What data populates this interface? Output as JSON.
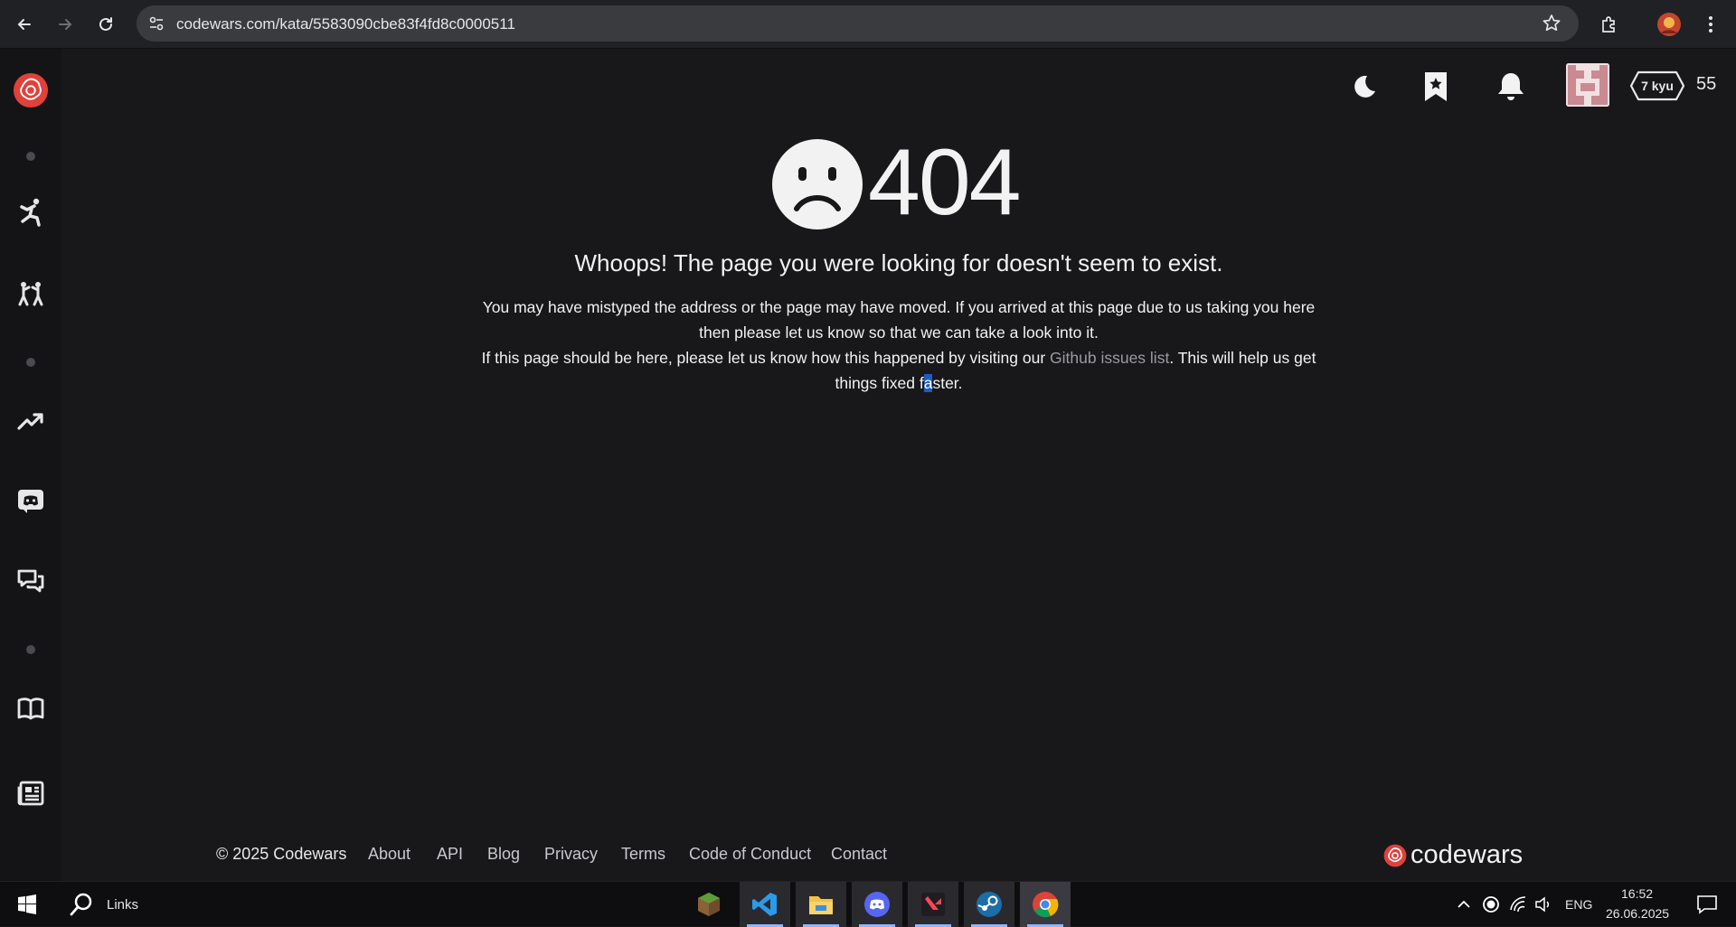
{
  "browser": {
    "url": "codewars.com/kata/5583090cbe83f4fd8c0000511"
  },
  "header": {
    "rank": "7 kyu",
    "honor": "55"
  },
  "main": {
    "code": "404",
    "headline": "Whoops! The page you were looking for doesn't seem to exist.",
    "para1": "You may have mistyped the address or the page may have moved. If you arrived at this page due to us taking you here then please let us know so that we can take a look into it.",
    "para2_pre": "If this page should be here, please let us know how this happened by visiting our ",
    "para2_link": "Github issues list",
    "para2_post": ". This will help us get things fixed f",
    "para2_sel": "a",
    "para2_end": "ster."
  },
  "footer": {
    "copyright": "© 2025 Codewars",
    "links": [
      "About",
      "API",
      "Blog",
      "Privacy",
      "Terms",
      "Code of Conduct",
      "Contact"
    ],
    "brand": "codewars"
  },
  "taskbar": {
    "search_label": "Links",
    "lang": "ENG",
    "time": "16:52",
    "date": "26.06.2025"
  },
  "colors": {
    "brand_red": "#e0413b",
    "background": "#18181b",
    "sidebar": "#141417"
  }
}
